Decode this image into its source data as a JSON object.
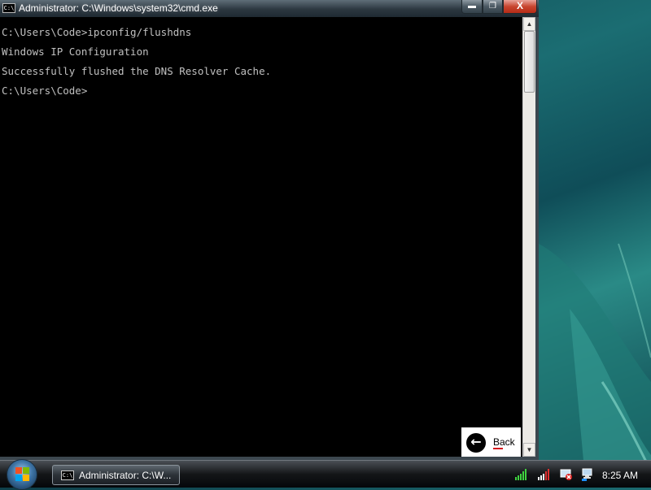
{
  "window": {
    "title": "Administrator: C:\\Windows\\system32\\cmd.exe",
    "icon_text": "C:\\",
    "controls": {
      "minimize": "icon",
      "maximize": "icon",
      "close": "X"
    }
  },
  "console": {
    "lines": [
      "C:\\Users\\Code>ipconfig/flushdns",
      "Windows IP Configuration",
      "Successfully flushed the DNS Resolver Cache.",
      "C:\\Users\\Code>"
    ],
    "text_color": "#c0c0c0",
    "background": "#000000"
  },
  "overlay": {
    "back_label": "Back",
    "back_icon": "arrow-left-icon"
  },
  "taskbar": {
    "start_icon": "windows-logo-icon",
    "task_button_label": "Administrator: C:\\W...",
    "task_icon_text": "C:\\",
    "tray": {
      "icons": [
        "signal-icon",
        "network-icon",
        "security-icon",
        "network-connection-icon"
      ],
      "clock": "8:25 AM"
    }
  }
}
